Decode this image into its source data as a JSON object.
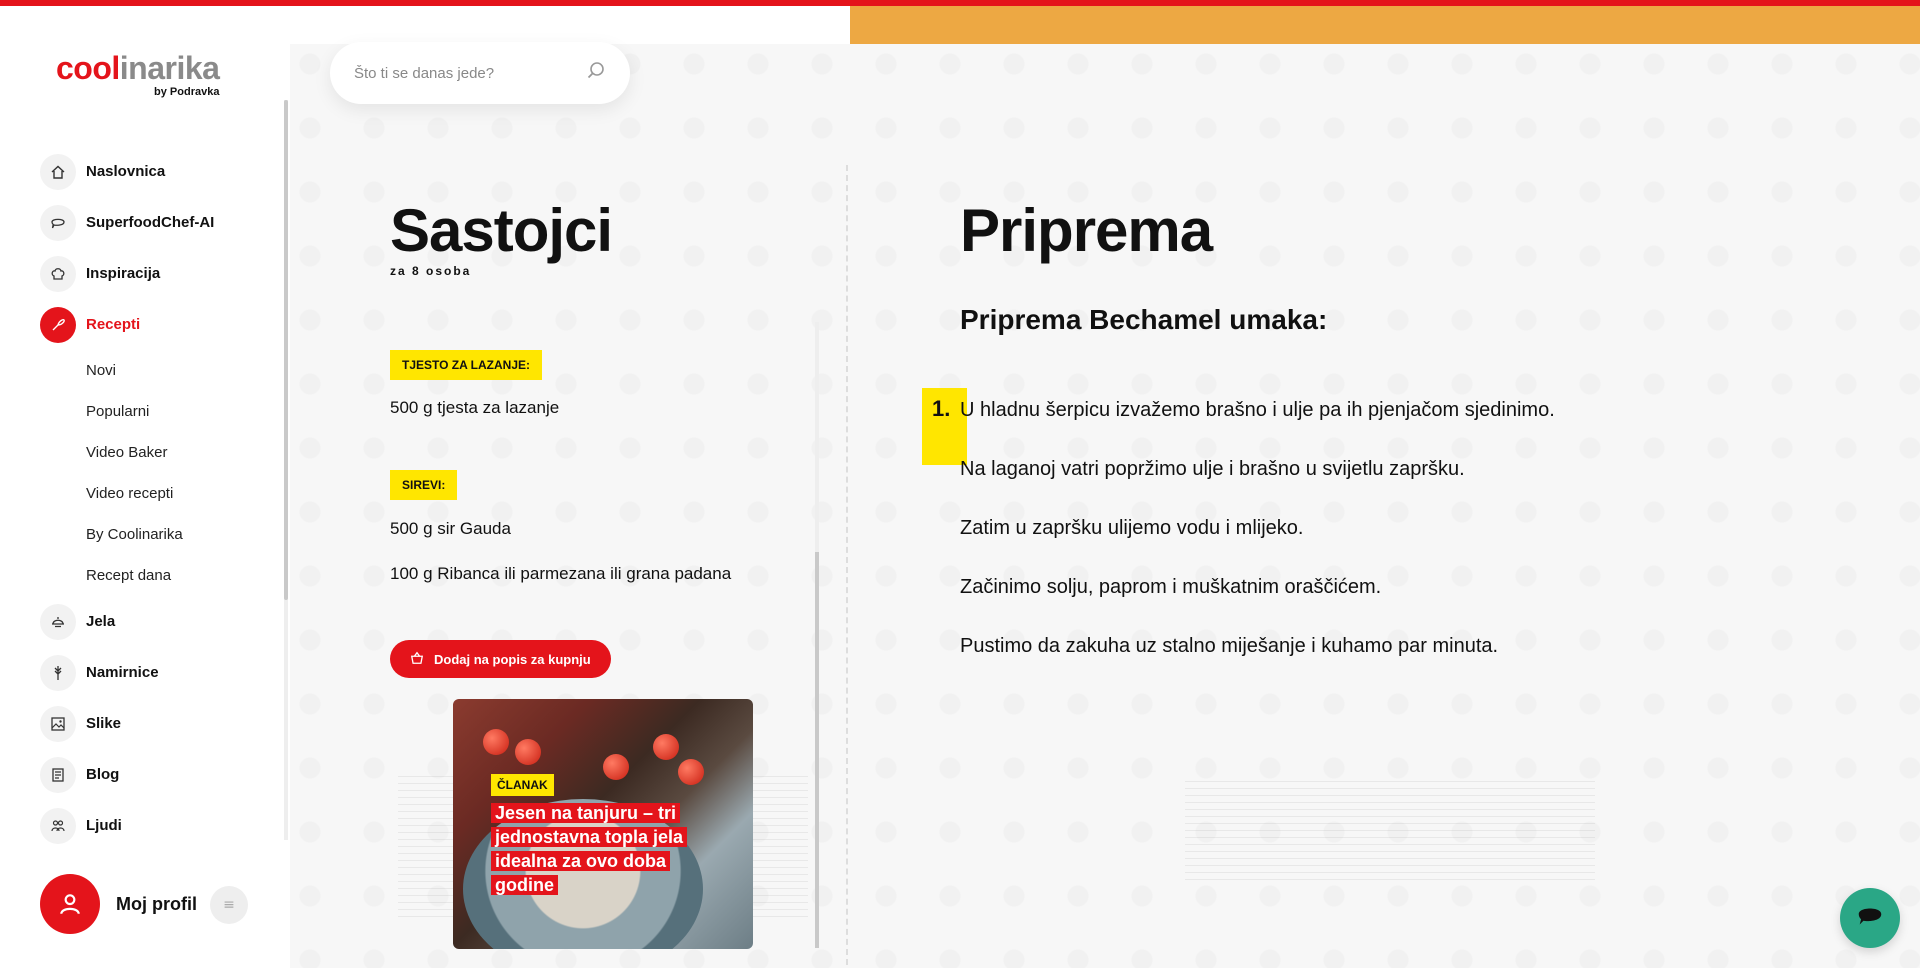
{
  "brand": {
    "logo_part1": "cool",
    "logo_part2": "inarika",
    "logo_sub": "by Podravka",
    "accent_color": "#e4141b",
    "highlight_color": "#ffe600"
  },
  "search": {
    "placeholder": "Što ti se danas jede?",
    "icon": "search-icon"
  },
  "sidebar": {
    "items": [
      {
        "label": "Naslovnica",
        "icon": "home-icon"
      },
      {
        "label": "SuperfoodChef-AI",
        "icon": "chat-bubble-icon"
      },
      {
        "label": "Inspiracija",
        "icon": "chef-hat-icon"
      },
      {
        "label": "Recepti",
        "icon": "whisk-icon",
        "active": true
      }
    ],
    "subitems": [
      "Novi",
      "Popularni",
      "Video Baker",
      "Video recepti",
      "By Coolinarika",
      "Recept dana"
    ],
    "items_after": [
      {
        "label": "Jela",
        "icon": "dish-icon"
      },
      {
        "label": "Namirnice",
        "icon": "wheat-icon"
      },
      {
        "label": "Slike",
        "icon": "image-icon"
      },
      {
        "label": "Blog",
        "icon": "blog-icon"
      },
      {
        "label": "Ljudi",
        "icon": "people-icon"
      }
    ],
    "profile_label": "Moj profil",
    "profile_menu_icon": "menu-icon"
  },
  "ingredients": {
    "title": "Sastojci",
    "servings": "za 8 osoba",
    "groups": [
      {
        "tag": "TJESTO ZA LAZANJE:",
        "lines": [
          "500 g tjesta za lazanje"
        ]
      },
      {
        "tag": "SIREVI:",
        "lines": [
          "500 g sir Gauda",
          "100 g Ribanca ili parmezana ili grana padana"
        ]
      }
    ],
    "add_button": "Dodaj na popis za kupnju"
  },
  "article": {
    "tag": "ČLANAK",
    "title": "Jesen na tanjuru – tri jednostavna topla jela idealna za ovo doba godine"
  },
  "preparation": {
    "title": "Priprema",
    "subtitle": "Priprema Bechamel umaka:",
    "step_number": "1.",
    "steps": [
      "U hladnu šerpicu izvažemo brašno i ulje pa ih pjenjačom sjedinimo.",
      "Na laganoj vatri popržimo ulje i brašno u svijetlu zapršku.",
      "Zatim u zapršku ulijemo vodu i mlijeko.",
      "Začinimo solju, paprom i muškatnim oraščićem.",
      "Pustimo da zakuha uz stalno miješanje i kuhamo par minuta."
    ]
  },
  "chat": {
    "icon": "chat-icon",
    "color": "#2aa786"
  }
}
